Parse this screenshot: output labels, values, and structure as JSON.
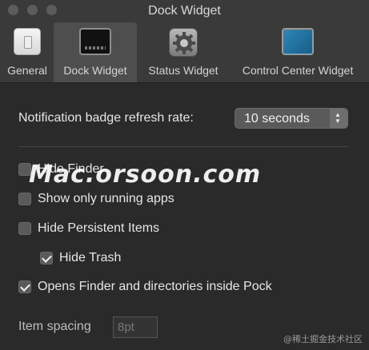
{
  "window": {
    "title": "Dock Widget",
    "traffic_lights": [
      "close",
      "minimize",
      "zoom"
    ]
  },
  "tabs": [
    {
      "label": "General",
      "icon": "general-icon",
      "selected": false
    },
    {
      "label": "Dock Widget",
      "icon": "dock-widget-icon",
      "selected": true
    },
    {
      "label": "Status Widget",
      "icon": "gear-icon",
      "selected": false
    },
    {
      "label": "Control Center Widget",
      "icon": "control-center-icon",
      "selected": false
    }
  ],
  "settings": {
    "refresh_label": "Notification badge refresh rate:",
    "refresh_value": "10 seconds",
    "checkboxes": [
      {
        "label": "Hide Finder",
        "checked": false
      },
      {
        "label": "Show only running apps",
        "checked": false
      },
      {
        "label": "Hide Persistent Items",
        "checked": false
      },
      {
        "label": "Hide Trash",
        "checked": true
      },
      {
        "label": "Opens Finder and directories inside Pock",
        "checked": true
      }
    ],
    "spacing_label": "Item spacing",
    "spacing_placeholder": "8pt"
  },
  "watermark": "Mac.orsoon.com",
  "credit": "@稀土掘金技术社区"
}
